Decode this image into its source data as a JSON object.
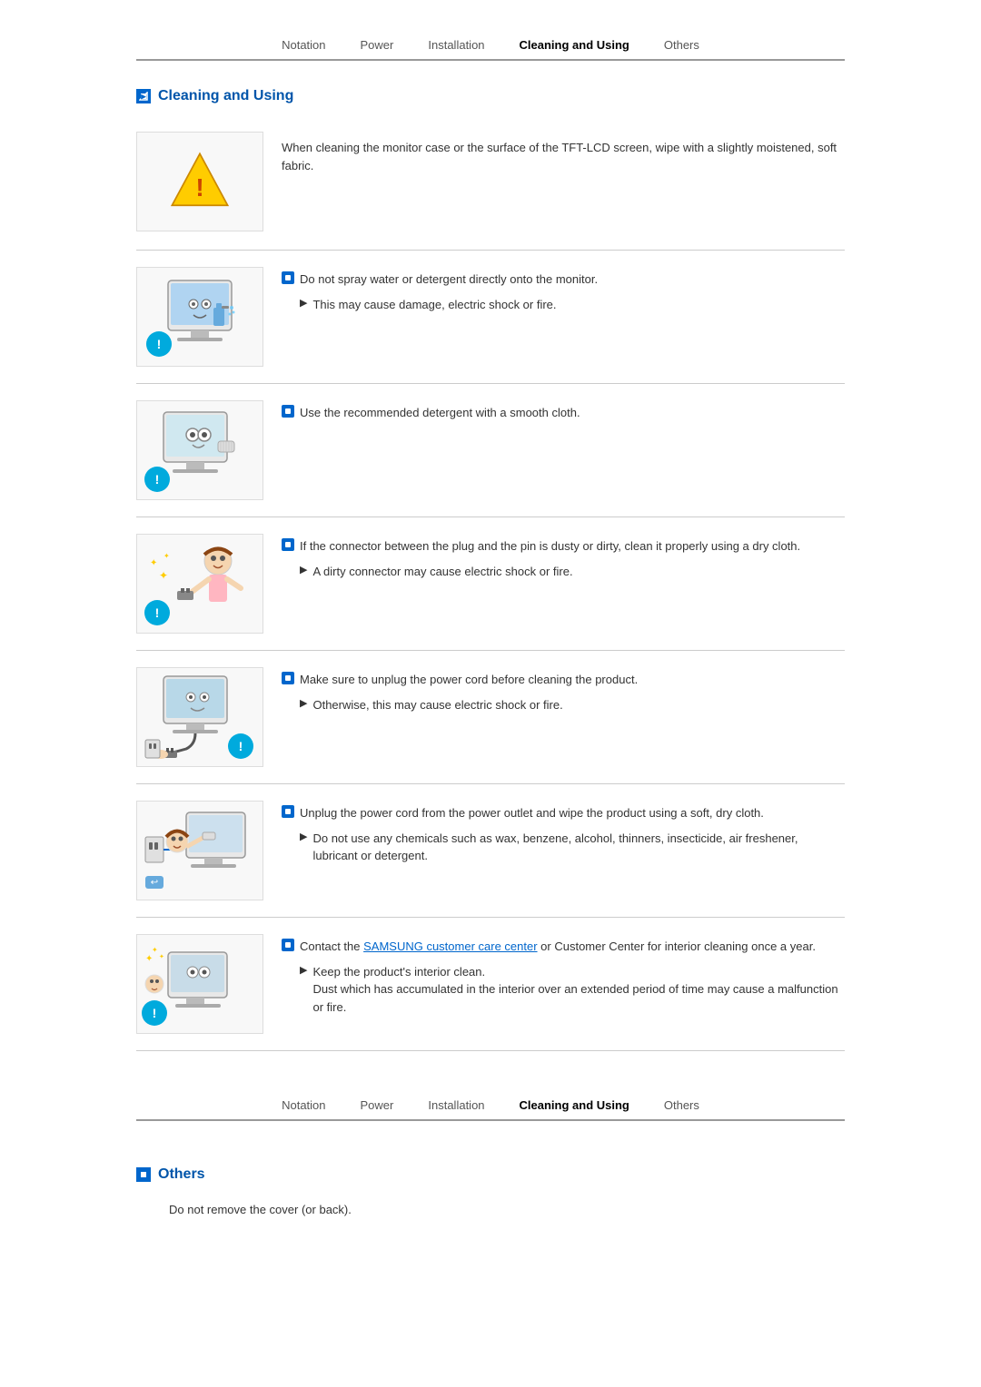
{
  "nav": {
    "tabs": [
      {
        "label": "Notation",
        "active": false
      },
      {
        "label": "Power",
        "active": false
      },
      {
        "label": "Installation",
        "active": false
      },
      {
        "label": "Cleaning and Using",
        "active": true
      },
      {
        "label": "Others",
        "active": false
      }
    ]
  },
  "section1": {
    "title": "Cleaning and Using",
    "intro": "When cleaning the monitor case or the surface of the TFT-LCD screen, wipe with a slightly moistened, soft fabric.",
    "items": [
      {
        "main": "Do not spray water or detergent directly onto the monitor.",
        "sub": "This may cause damage, electric shock or fire."
      },
      {
        "main": "Use the recommended detergent with a smooth cloth.",
        "sub": null
      },
      {
        "main": "If the connector between the plug and the pin is dusty or dirty, clean it properly using a dry cloth.",
        "sub": "A dirty connector may cause electric shock or fire."
      },
      {
        "main": "Make sure to unplug the power cord before cleaning the product.",
        "sub": "Otherwise, this may cause electric shock or fire."
      },
      {
        "main": "Unplug the power cord from the power outlet and wipe the product using a soft, dry cloth.",
        "sub": "Do not use any chemicals such as wax, benzene, alcohol, thinners, insecticide, air freshener, lubricant or detergent."
      },
      {
        "main_prefix": "Contact the ",
        "main_link": "SAMSUNG customer care center",
        "main_suffix": " or Customer Center for interior cleaning once a year.",
        "sub": "Keep the product's interior clean.\nDust which has accumulated in the interior over an extended period of time may cause a malfunction or fire."
      }
    ]
  },
  "section2": {
    "title": "Others",
    "items": [
      {
        "main": "Do not remove the cover (or back).",
        "sub": null
      }
    ]
  }
}
